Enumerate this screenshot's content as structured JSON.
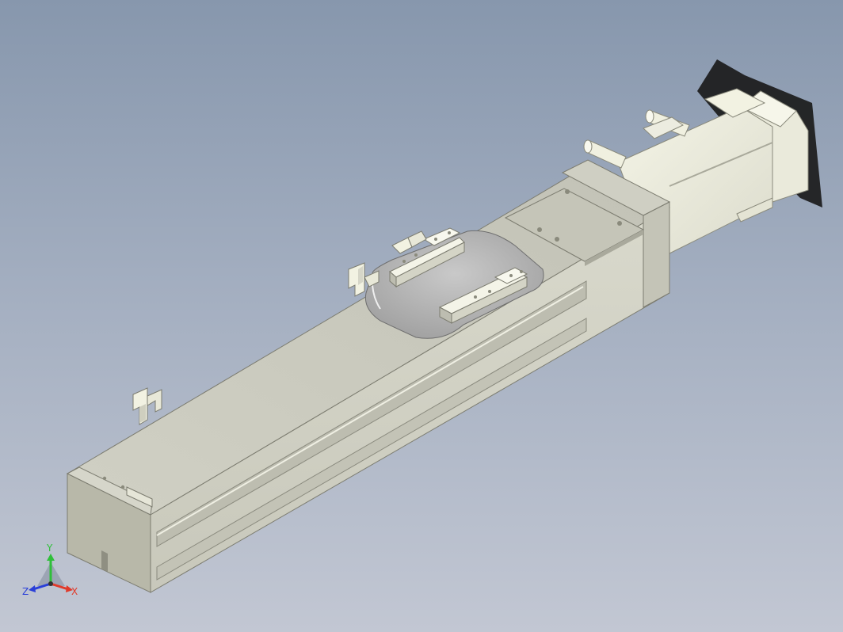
{
  "viewport": {
    "kind": "3d-cad-view",
    "subject": "linear-actuator-module"
  },
  "colors": {
    "background_top": "#8797ad",
    "background_bottom": "#c2c7d3",
    "body_top": "#c9c9be",
    "body_side": "#d3d3c6",
    "body_front": "#b4b4a6",
    "edge": "#6f6f64",
    "accent_cream": "#f2f2e2",
    "shadow": "#1b1b1b",
    "axis_x": "#e03a2a",
    "axis_y": "#2fbf3a",
    "axis_z": "#2a3fd8"
  },
  "triad": {
    "x_label": "X",
    "y_label": "Y",
    "z_label": "Z"
  }
}
